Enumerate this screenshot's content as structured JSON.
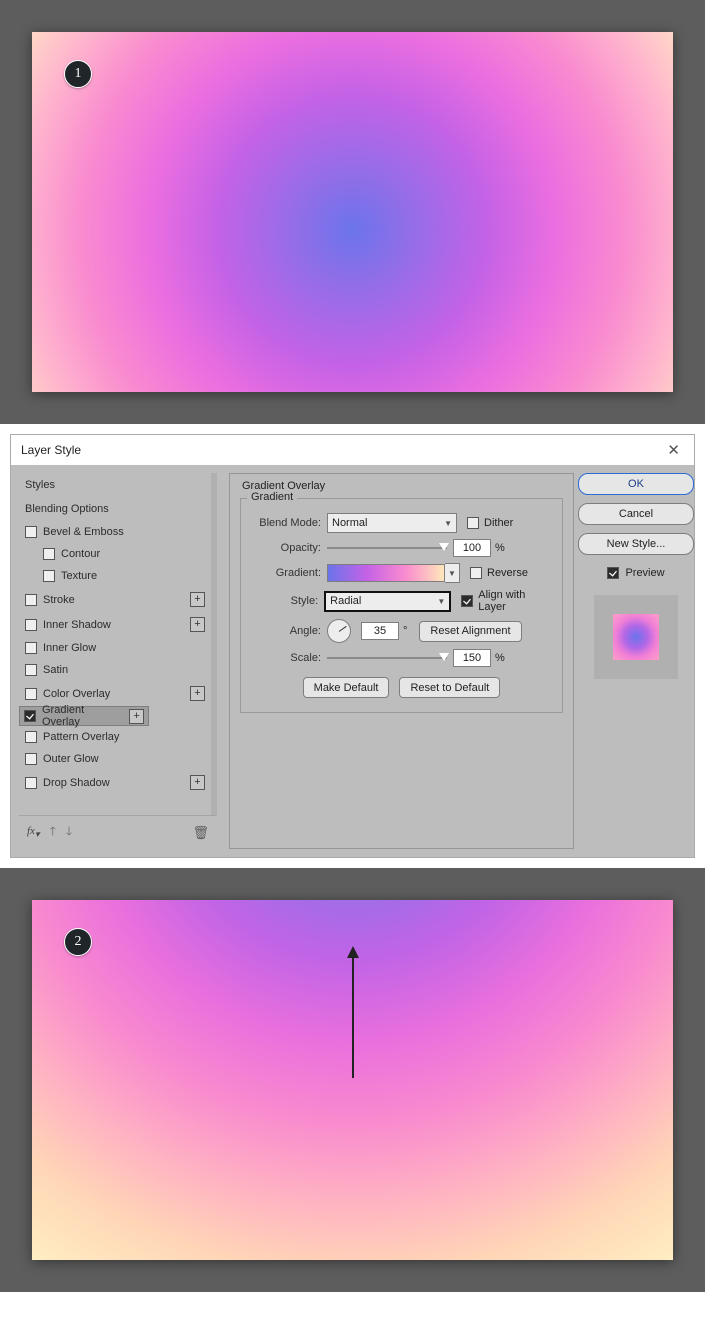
{
  "badge1": "1",
  "badge2": "2",
  "dialog": {
    "title": "Layer Style",
    "section_title": "Gradient Overlay",
    "fieldset_title": "Gradient",
    "labels": {
      "blend_mode": "Blend Mode:",
      "opacity": "Opacity:",
      "gradient": "Gradient:",
      "style": "Style:",
      "angle": "Angle:",
      "scale": "Scale:"
    },
    "values": {
      "blend_mode": "Normal",
      "opacity": "100",
      "style": "Radial",
      "angle": "35",
      "scale": "150"
    },
    "units": {
      "pct": "%",
      "deg": "°"
    },
    "checks": {
      "dither": "Dither",
      "reverse": "Reverse",
      "align": "Align with Layer",
      "preview": "Preview"
    },
    "buttons": {
      "ok": "OK",
      "cancel": "Cancel",
      "new_style": "New Style...",
      "reset_align": "Reset Alignment",
      "make_default": "Make Default",
      "reset_default": "Reset to Default"
    }
  },
  "sidebar": {
    "styles": "Styles",
    "blending": "Blending Options",
    "bevel": "Bevel & Emboss",
    "contour": "Contour",
    "texture": "Texture",
    "stroke": "Stroke",
    "inner_shadow": "Inner Shadow",
    "inner_glow": "Inner Glow",
    "satin": "Satin",
    "color_overlay": "Color Overlay",
    "gradient_overlay": "Gradient Overlay",
    "pattern_overlay": "Pattern Overlay",
    "outer_glow": "Outer Glow",
    "drop_shadow": "Drop Shadow",
    "fx": "fx"
  }
}
